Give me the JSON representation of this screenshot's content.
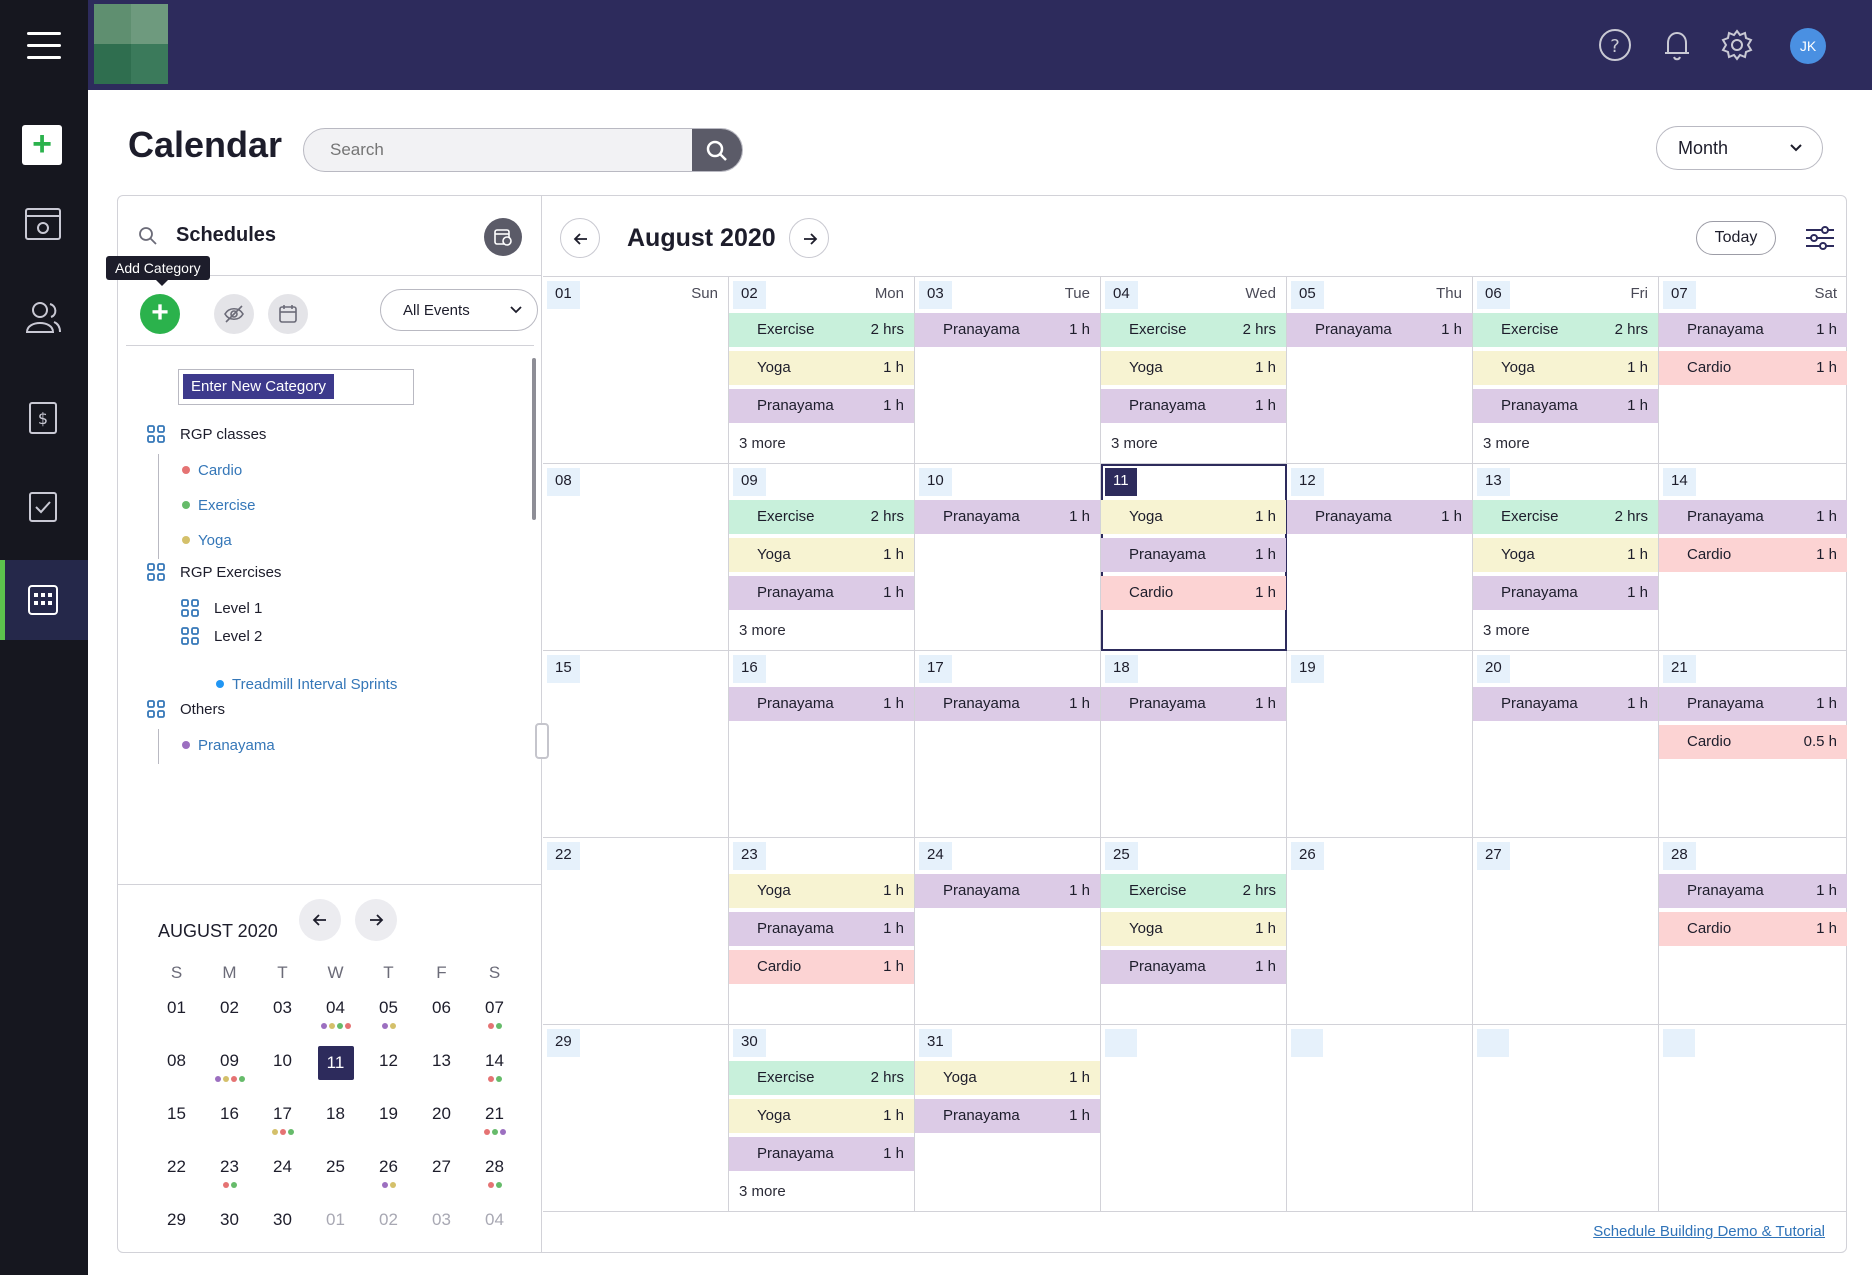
{
  "header": {
    "avatar_initials": "JK",
    "page_title": "Calendar",
    "search_placeholder": "Search",
    "view_select": "Month"
  },
  "schedules": {
    "title": "Schedules",
    "tooltip": "Add Category",
    "events_filter": "All Events",
    "new_category_placeholder": "Enter New Category",
    "tree": [
      {
        "group": "RGP classes",
        "items": [
          {
            "label": "Cardio",
            "color": "#e57373"
          },
          {
            "label": "Exercise",
            "color": "#66bb6a"
          },
          {
            "label": "Yoga",
            "color": "#d4c06a"
          }
        ]
      },
      {
        "group": "RGP Exercises",
        "subgroups": [
          "Level 1",
          "Level 2"
        ],
        "items": [
          {
            "label": "Treadmill Interval Sprints",
            "color": "#2196f3"
          }
        ]
      },
      {
        "group": "Others",
        "items": [
          {
            "label": "Pranayama",
            "color": "#9c6fc0"
          }
        ]
      }
    ]
  },
  "mini_calendar": {
    "title": "AUGUST 2020",
    "weekdays": [
      "S",
      "M",
      "T",
      "W",
      "T",
      "F",
      "S"
    ],
    "weeks": [
      [
        {
          "d": "01"
        },
        {
          "d": "02"
        },
        {
          "d": "03"
        },
        {
          "d": "04",
          "dots": [
            "#9c6fc0",
            "#d4c06a",
            "#66bb6a",
            "#e57373"
          ]
        },
        {
          "d": "05",
          "dots": [
            "#9c6fc0",
            "#d4c06a"
          ]
        },
        {
          "d": "06"
        },
        {
          "d": "07",
          "dots": [
            "#e57373",
            "#66bb6a"
          ]
        }
      ],
      [
        {
          "d": "08"
        },
        {
          "d": "09",
          "dots": [
            "#9c6fc0",
            "#d4c06a",
            "#e57373",
            "#66bb6a"
          ]
        },
        {
          "d": "10"
        },
        {
          "d": "11",
          "selected": true
        },
        {
          "d": "12"
        },
        {
          "d": "13"
        },
        {
          "d": "14",
          "dots": [
            "#e57373",
            "#66bb6a"
          ]
        }
      ],
      [
        {
          "d": "15"
        },
        {
          "d": "16"
        },
        {
          "d": "17",
          "dots": [
            "#d4c06a",
            "#e57373",
            "#66bb6a"
          ]
        },
        {
          "d": "18"
        },
        {
          "d": "19"
        },
        {
          "d": "20"
        },
        {
          "d": "21",
          "dots": [
            "#e57373",
            "#66bb6a",
            "#9c6fc0"
          ]
        }
      ],
      [
        {
          "d": "22"
        },
        {
          "d": "23",
          "dots": [
            "#e57373",
            "#66bb6a"
          ]
        },
        {
          "d": "24"
        },
        {
          "d": "25"
        },
        {
          "d": "26",
          "dots": [
            "#9c6fc0",
            "#d4c06a"
          ]
        },
        {
          "d": "27"
        },
        {
          "d": "28",
          "dots": [
            "#e57373",
            "#66bb6a"
          ]
        }
      ],
      [
        {
          "d": "29"
        },
        {
          "d": "30"
        },
        {
          "d": "30"
        },
        {
          "d": "01",
          "muted": true
        },
        {
          "d": "02",
          "muted": true
        },
        {
          "d": "03",
          "muted": true
        },
        {
          "d": "04",
          "muted": true
        }
      ]
    ]
  },
  "month_view": {
    "title": "August 2020",
    "today_label": "Today",
    "tutorial_link": "Schedule Building Demo & Tutorial",
    "weeks": [
      [
        {
          "d": "01",
          "name": "Sun",
          "events": []
        },
        {
          "d": "02",
          "name": "Mon",
          "events": [
            {
              "t": "Exercise",
              "dur": "2 hrs",
              "c": "exercise"
            },
            {
              "t": "Yoga",
              "dur": "1 h",
              "c": "yoga"
            },
            {
              "t": "Pranayama",
              "dur": "1 h",
              "c": "pranayama"
            }
          ],
          "more": "3 more"
        },
        {
          "d": "03",
          "name": "Tue",
          "events": [
            {
              "t": "Pranayama",
              "dur": "1 h",
              "c": "pranayama"
            }
          ]
        },
        {
          "d": "04",
          "name": "Wed",
          "events": [
            {
              "t": "Exercise",
              "dur": "2 hrs",
              "c": "exercise"
            },
            {
              "t": "Yoga",
              "dur": "1 h",
              "c": "yoga"
            },
            {
              "t": "Pranayama",
              "dur": "1 h",
              "c": "pranayama"
            }
          ],
          "more": "3 more"
        },
        {
          "d": "05",
          "name": "Thu",
          "events": [
            {
              "t": "Pranayama",
              "dur": "1 h",
              "c": "pranayama"
            }
          ]
        },
        {
          "d": "06",
          "name": "Fri",
          "events": [
            {
              "t": "Exercise",
              "dur": "2 hrs",
              "c": "exercise"
            },
            {
              "t": "Yoga",
              "dur": "1 h",
              "c": "yoga"
            },
            {
              "t": "Pranayama",
              "dur": "1 h",
              "c": "pranayama"
            }
          ],
          "more": "3 more"
        },
        {
          "d": "07",
          "name": "Sat",
          "events": [
            {
              "t": "Pranayama",
              "dur": "1 h",
              "c": "pranayama"
            },
            {
              "t": "Cardio",
              "dur": "1 h",
              "c": "cardio"
            }
          ]
        }
      ],
      [
        {
          "d": "08",
          "events": []
        },
        {
          "d": "09",
          "events": [
            {
              "t": "Exercise",
              "dur": "2 hrs",
              "c": "exercise"
            },
            {
              "t": "Yoga",
              "dur": "1 h",
              "c": "yoga"
            },
            {
              "t": "Pranayama",
              "dur": "1 h",
              "c": "pranayama"
            }
          ],
          "more": "3 more"
        },
        {
          "d": "10",
          "events": [
            {
              "t": "Pranayama",
              "dur": "1 h",
              "c": "pranayama"
            }
          ]
        },
        {
          "d": "11",
          "today": true,
          "events": [
            {
              "t": "Yoga",
              "dur": "1 h",
              "c": "yoga"
            },
            {
              "t": "Pranayama",
              "dur": "1 h",
              "c": "pranayama"
            },
            {
              "t": "Cardio",
              "dur": "1 h",
              "c": "cardio"
            }
          ]
        },
        {
          "d": "12",
          "events": [
            {
              "t": "Pranayama",
              "dur": "1 h",
              "c": "pranayama"
            }
          ]
        },
        {
          "d": "13",
          "events": [
            {
              "t": "Exercise",
              "dur": "2 hrs",
              "c": "exercise"
            },
            {
              "t": "Yoga",
              "dur": "1 h",
              "c": "yoga"
            },
            {
              "t": "Pranayama",
              "dur": "1 h",
              "c": "pranayama"
            }
          ],
          "more": "3 more"
        },
        {
          "d": "14",
          "events": [
            {
              "t": "Pranayama",
              "dur": "1 h",
              "c": "pranayama"
            },
            {
              "t": "Cardio",
              "dur": "1 h",
              "c": "cardio"
            }
          ]
        }
      ],
      [
        {
          "d": "15",
          "events": []
        },
        {
          "d": "16",
          "events": [
            {
              "t": "Pranayama",
              "dur": "1 h",
              "c": "pranayama"
            }
          ]
        },
        {
          "d": "17",
          "events": [
            {
              "t": "Pranayama",
              "dur": "1 h",
              "c": "pranayama"
            }
          ]
        },
        {
          "d": "18",
          "events": [
            {
              "t": "Pranayama",
              "dur": "1 h",
              "c": "pranayama"
            }
          ]
        },
        {
          "d": "19",
          "events": []
        },
        {
          "d": "20",
          "events": [
            {
              "t": "Pranayama",
              "dur": "1 h",
              "c": "pranayama"
            }
          ]
        },
        {
          "d": "21",
          "events": [
            {
              "t": "Pranayama",
              "dur": "1 h",
              "c": "pranayama"
            },
            {
              "t": "Cardio",
              "dur": "0.5 h",
              "c": "cardio"
            }
          ]
        }
      ],
      [
        {
          "d": "22",
          "events": []
        },
        {
          "d": "23",
          "events": [
            {
              "t": "Yoga",
              "dur": "1 h",
              "c": "yoga"
            },
            {
              "t": "Pranayama",
              "dur": "1 h",
              "c": "pranayama"
            },
            {
              "t": "Cardio",
              "dur": "1 h",
              "c": "cardio"
            }
          ]
        },
        {
          "d": "24",
          "events": [
            {
              "t": "Pranayama",
              "dur": "1 h",
              "c": "pranayama"
            }
          ]
        },
        {
          "d": "25",
          "events": [
            {
              "t": "Exercise",
              "dur": "2 hrs",
              "c": "exercise"
            },
            {
              "t": "Yoga",
              "dur": "1 h",
              "c": "yoga"
            },
            {
              "t": "Pranayama",
              "dur": "1 h",
              "c": "pranayama"
            }
          ]
        },
        {
          "d": "26",
          "events": []
        },
        {
          "d": "27",
          "events": []
        },
        {
          "d": "28",
          "events": [
            {
              "t": "Pranayama",
              "dur": "1 h",
              "c": "pranayama"
            },
            {
              "t": "Cardio",
              "dur": "1 h",
              "c": "cardio"
            }
          ]
        }
      ],
      [
        {
          "d": "29",
          "events": []
        },
        {
          "d": "30",
          "events": [
            {
              "t": "Exercise",
              "dur": "2 hrs",
              "c": "exercise"
            },
            {
              "t": "Yoga",
              "dur": "1 h",
              "c": "yoga"
            },
            {
              "t": "Pranayama",
              "dur": "1 h",
              "c": "pranayama"
            }
          ],
          "more": "3 more"
        },
        {
          "d": "31",
          "events": [
            {
              "t": "Yoga",
              "dur": "1 h",
              "c": "yoga"
            },
            {
              "t": "Pranayama",
              "dur": "1 h",
              "c": "pranayama"
            }
          ]
        },
        {
          "d": "",
          "events": []
        },
        {
          "d": "",
          "events": []
        },
        {
          "d": "",
          "events": []
        },
        {
          "d": "",
          "events": []
        }
      ]
    ]
  }
}
